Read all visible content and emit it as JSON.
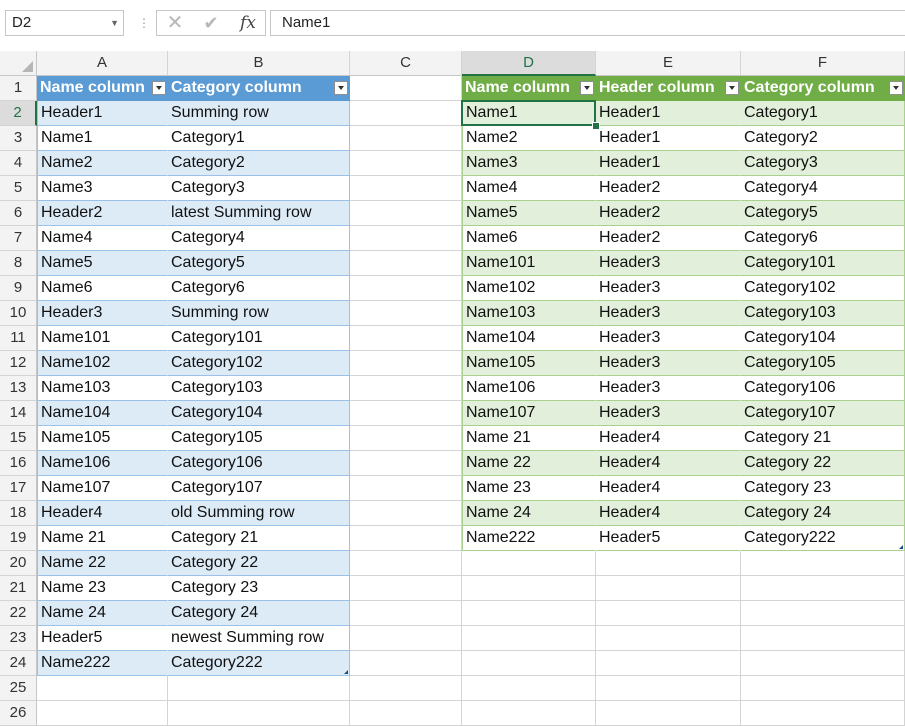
{
  "formula_bar": {
    "name_box": "D2",
    "formula": "Name1",
    "cancel_icon": "✕",
    "enter_icon": "✔",
    "fx_icon": "fx"
  },
  "columns": [
    "A",
    "B",
    "C",
    "D",
    "E",
    "F"
  ],
  "rows": [
    "1",
    "2",
    "3",
    "4",
    "5",
    "6",
    "7",
    "8",
    "9",
    "10",
    "11",
    "12",
    "13",
    "14",
    "15",
    "16",
    "17",
    "18",
    "19",
    "20",
    "21",
    "22",
    "23",
    "24",
    "25",
    "26"
  ],
  "selected": {
    "column": "D",
    "row": "2"
  },
  "table_left": {
    "style_color": "#5b9bd5",
    "headers": [
      "Name column",
      "Category column"
    ],
    "rows": [
      [
        "Header1",
        "Summing row"
      ],
      [
        "Name1",
        "Category1"
      ],
      [
        "Name2",
        "Category2"
      ],
      [
        "Name3",
        "Category3"
      ],
      [
        "Header2",
        "latest Summing row"
      ],
      [
        "Name4",
        "Category4"
      ],
      [
        "Name5",
        "Category5"
      ],
      [
        "Name6",
        "Category6"
      ],
      [
        "Header3",
        "Summing row"
      ],
      [
        "Name101",
        "Category101"
      ],
      [
        "Name102",
        "Category102"
      ],
      [
        "Name103",
        "Category103"
      ],
      [
        "Name104",
        "Category104"
      ],
      [
        "Name105",
        "Category105"
      ],
      [
        "Name106",
        "Category106"
      ],
      [
        "Name107",
        "Category107"
      ],
      [
        "Header4",
        "old Summing row"
      ],
      [
        "Name 21",
        "Category 21"
      ],
      [
        "Name 22",
        "Category 22"
      ],
      [
        "Name 23",
        "Category 23"
      ],
      [
        "Name 24",
        "Category 24"
      ],
      [
        "Header5",
        "newest Summing row"
      ],
      [
        "Name222",
        "Category222"
      ]
    ]
  },
  "table_right": {
    "style_color": "#70ad47",
    "headers": [
      "Name column",
      "Header column",
      "Category column"
    ],
    "rows": [
      [
        "Name1",
        "Header1",
        "Category1"
      ],
      [
        "Name2",
        "Header1",
        "Category2"
      ],
      [
        "Name3",
        "Header1",
        "Category3"
      ],
      [
        "Name4",
        "Header2",
        "Category4"
      ],
      [
        "Name5",
        "Header2",
        "Category5"
      ],
      [
        "Name6",
        "Header2",
        "Category6"
      ],
      [
        "Name101",
        "Header3",
        "Category101"
      ],
      [
        "Name102",
        "Header3",
        "Category102"
      ],
      [
        "Name103",
        "Header3",
        "Category103"
      ],
      [
        "Name104",
        "Header3",
        "Category104"
      ],
      [
        "Name105",
        "Header3",
        "Category105"
      ],
      [
        "Name106",
        "Header3",
        "Category106"
      ],
      [
        "Name107",
        "Header3",
        "Category107"
      ],
      [
        "Name 21",
        "Header4",
        "Category 21"
      ],
      [
        "Name 22",
        "Header4",
        "Category 22"
      ],
      [
        "Name 23",
        "Header4",
        "Category 23"
      ],
      [
        "Name 24",
        "Header4",
        "Category 24"
      ],
      [
        "Name222",
        "Header5",
        "Category222"
      ]
    ]
  }
}
